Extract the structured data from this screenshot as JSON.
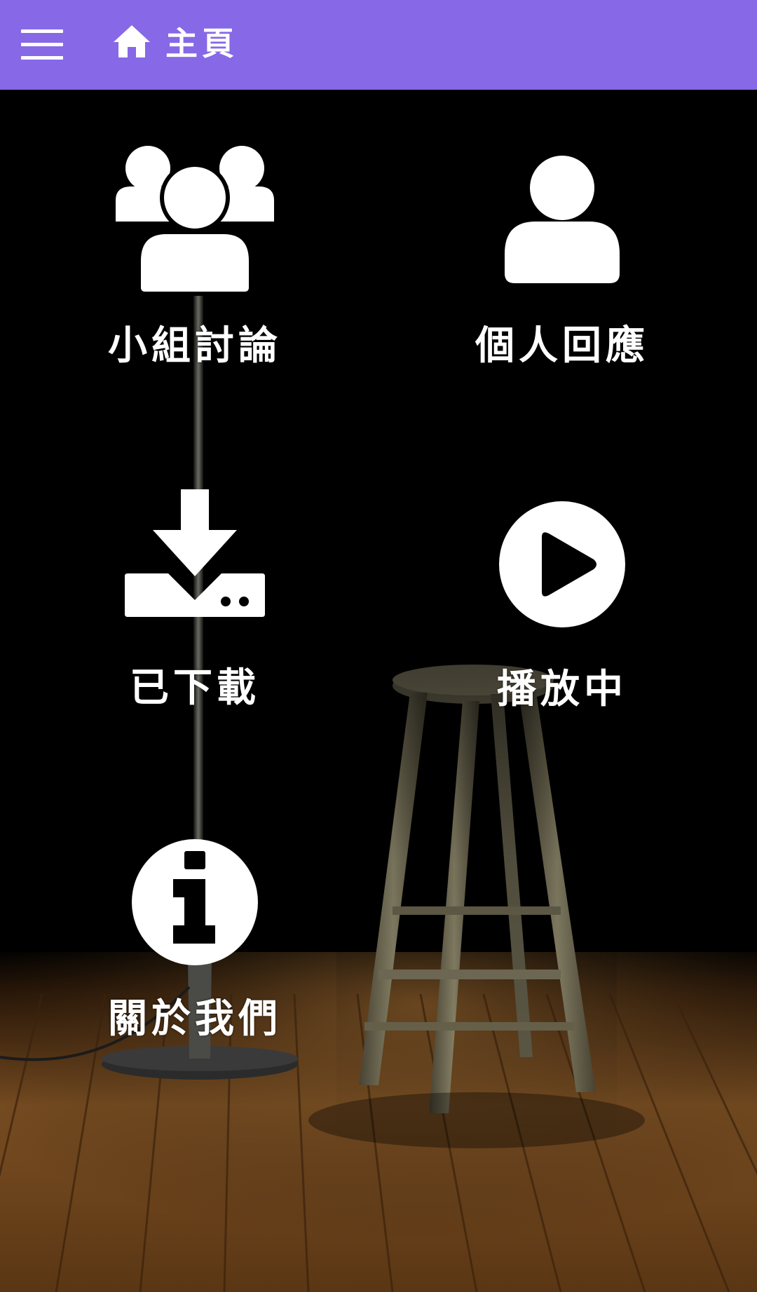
{
  "app_bar": {
    "title": "主頁",
    "menu_icon": "hamburger-menu-icon",
    "home_icon": "home-icon",
    "background_color": "#8768e6"
  },
  "menu": [
    {
      "label": "小組討論",
      "icon": "group-icon"
    },
    {
      "label": "個人回應",
      "icon": "person-icon"
    },
    {
      "label": "已下載",
      "icon": "download-icon"
    },
    {
      "label": "播放中",
      "icon": "play-circle-icon"
    },
    {
      "label": "關於我們",
      "icon": "info-icon"
    }
  ]
}
